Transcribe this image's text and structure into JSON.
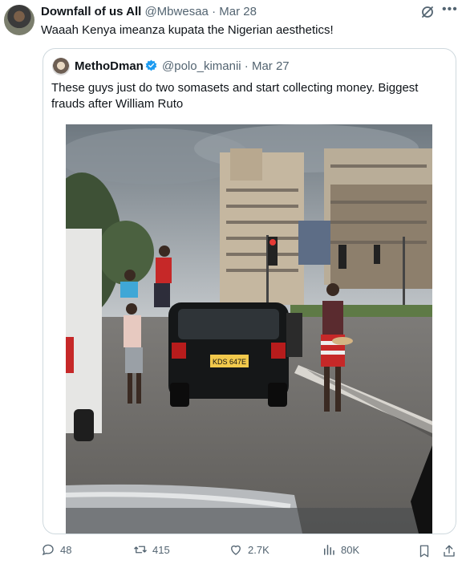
{
  "tweet": {
    "author_name": "Downfall of us All",
    "handle": "@Mbwesaa",
    "separator": "·",
    "date": "Mar 28",
    "text": "Waaah Kenya imeanza kupata the Nigerian aesthetics!"
  },
  "quoted": {
    "author_name": "MethoDman",
    "handle": "@polo_kimanii",
    "separator": "·",
    "date": "Mar 27",
    "text": "These guys just do two somasets and start collecting money. Biggest frauds after William Ruto",
    "license_plate": "KDS 647E"
  },
  "actions": {
    "replies": "48",
    "reposts": "415",
    "likes": "2.7K",
    "views": "80K"
  },
  "colors": {
    "accent": "#1d9bf0",
    "muted": "#536471"
  },
  "icons": [
    "grok-icon",
    "more-icon",
    "verified-icon",
    "reply-icon",
    "repost-icon",
    "like-icon",
    "views-icon",
    "bookmark-icon",
    "share-icon"
  ]
}
